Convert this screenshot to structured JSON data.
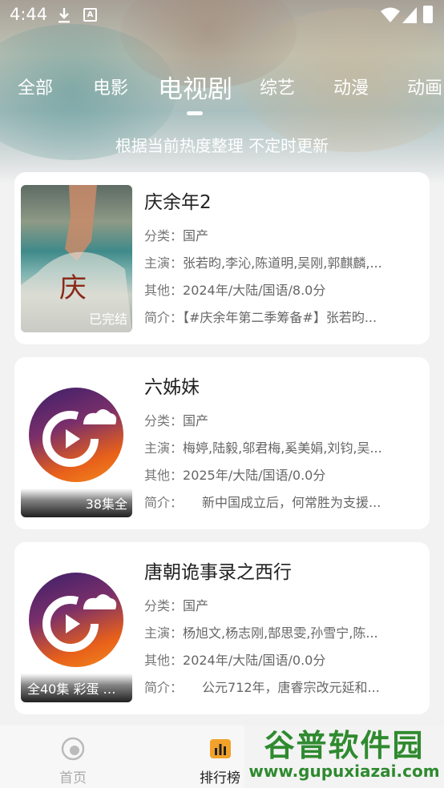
{
  "status_bar": {
    "time": "4:44",
    "a_icon_letter": "A"
  },
  "tabs": [
    {
      "label": "全部",
      "active": false
    },
    {
      "label": "电影",
      "active": false
    },
    {
      "label": "电视剧",
      "active": true
    },
    {
      "label": "综艺",
      "active": false
    },
    {
      "label": "动漫",
      "active": false
    },
    {
      "label": "动画",
      "active": false
    }
  ],
  "subtitle": "根据当前热度整理 不定时更新",
  "labels": {
    "category": "分类：",
    "cast": "主演：",
    "other": "其他：",
    "intro": "简介："
  },
  "cards": [
    {
      "title": "庆余年2",
      "badge": "已完结",
      "category": "国产",
      "cast": "张若昀,李沁,陈道明,吴刚,郭麒麟,...",
      "other": "2024年/大陆/国语/8.0分",
      "intro": "【#庆余年第二季筹备#】张若昀...",
      "poster_type": "image"
    },
    {
      "title": "六姊妹",
      "badge": "38集全",
      "category": "国产",
      "cast": "梅婷,陆毅,邬君梅,奚美娟,刘钧,吴...",
      "other": "2025年/大陆/国语/0.0分",
      "intro": "　　新中国成立后，何常胜为支援...",
      "poster_type": "logo"
    },
    {
      "title": "唐朝诡事录之西行",
      "badge": "全40集 彩蛋 花...",
      "category": "国产",
      "cast": "杨旭文,杨志刚,郜思雯,孙雪宁,陈...",
      "other": "2024年/大陆/国语/0.0分",
      "intro": "　　公元712年，唐睿宗改元延和...",
      "poster_type": "logo"
    }
  ],
  "bottom_nav": [
    {
      "label": "首页",
      "icon": "home-icon",
      "active": false
    },
    {
      "label": "排行榜",
      "icon": "ranking-icon",
      "active": true
    }
  ],
  "watermark": {
    "title": "谷普软件园",
    "url": "www.gupuxiazai.com"
  },
  "colors": {
    "watermark_green": "#2f8a2f",
    "ranking_orange": "#f2a22a"
  }
}
